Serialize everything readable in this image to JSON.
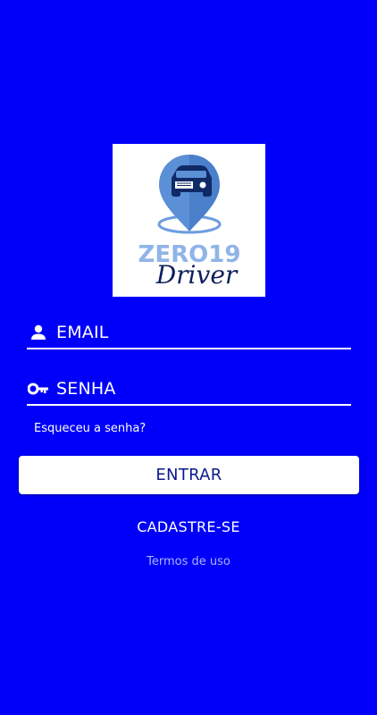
{
  "logo": {
    "brand_top": "ZERO19",
    "brand_script": "Driver",
    "colors": {
      "pin": "#5b8fd6",
      "pin_dark": "#1a3a78",
      "text_light": "#8fb4e8",
      "script": "#0b1f5c"
    }
  },
  "form": {
    "email_label": "EMAIL",
    "email_icon": "person-icon",
    "password_label": "SENHA",
    "password_icon": "key-icon",
    "forgot_link": "Esqueceu a senha?",
    "submit_label": "ENTRAR",
    "signup_link": "CADASTRE-SE",
    "terms_link": "Termos de uso"
  },
  "colors": {
    "background": "#0000fa",
    "button_bg": "#ffffff",
    "button_text": "#0a1a8c",
    "terms_text": "#a9b4ff"
  }
}
